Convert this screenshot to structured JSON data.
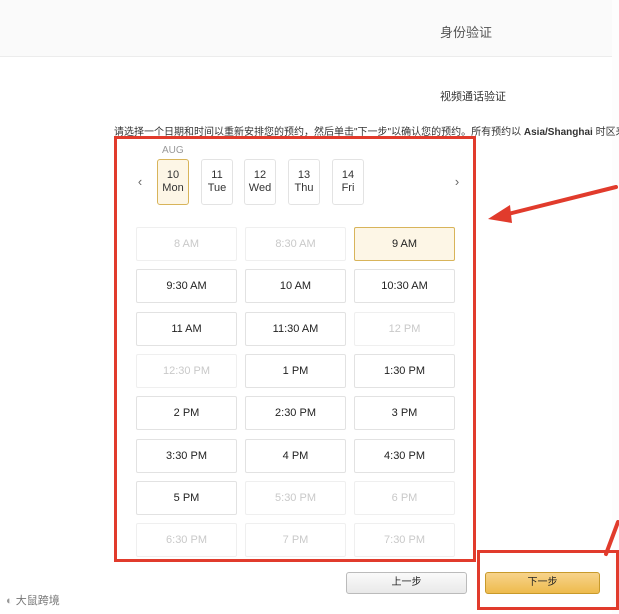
{
  "header": {
    "title": "身份验证"
  },
  "page": {
    "subtitle": "视频通话验证",
    "instruction_prefix": "请选择一个日期和时间以重新安排您的预约，然后单击\"下一步\"以确认您的预约。所有预约以 ",
    "instruction_timezone": "Asia/Shanghai",
    "instruction_suffix": " 时区来"
  },
  "calendar": {
    "month": "AUG",
    "dates": [
      {
        "day": "10",
        "weekday": "Mon",
        "selected": true
      },
      {
        "day": "11",
        "weekday": "Tue",
        "selected": false
      },
      {
        "day": "12",
        "weekday": "Wed",
        "selected": false
      },
      {
        "day": "13",
        "weekday": "Thu",
        "selected": false
      },
      {
        "day": "14",
        "weekday": "Fri",
        "selected": false
      }
    ],
    "prev_icon": "‹",
    "next_icon": "›"
  },
  "slots": [
    {
      "label": "8 AM",
      "state": "disabled"
    },
    {
      "label": "8:30 AM",
      "state": "disabled"
    },
    {
      "label": "9 AM",
      "state": "selected"
    },
    {
      "label": "9:30 AM",
      "state": "available"
    },
    {
      "label": "10 AM",
      "state": "available"
    },
    {
      "label": "10:30 AM",
      "state": "available"
    },
    {
      "label": "11 AM",
      "state": "available"
    },
    {
      "label": "11:30 AM",
      "state": "available"
    },
    {
      "label": "12 PM",
      "state": "disabled"
    },
    {
      "label": "12:30 PM",
      "state": "disabled"
    },
    {
      "label": "1 PM",
      "state": "available"
    },
    {
      "label": "1:30 PM",
      "state": "available"
    },
    {
      "label": "2 PM",
      "state": "available"
    },
    {
      "label": "2:30 PM",
      "state": "available"
    },
    {
      "label": "3 PM",
      "state": "available"
    },
    {
      "label": "3:30 PM",
      "state": "available"
    },
    {
      "label": "4 PM",
      "state": "available"
    },
    {
      "label": "4:30 PM",
      "state": "available"
    },
    {
      "label": "5 PM",
      "state": "available"
    },
    {
      "label": "5:30 PM",
      "state": "disabled"
    },
    {
      "label": "6 PM",
      "state": "disabled"
    },
    {
      "label": "6:30 PM",
      "state": "disabled"
    },
    {
      "label": "7 PM",
      "state": "disabled"
    },
    {
      "label": "7:30 PM",
      "state": "disabled"
    }
  ],
  "footer": {
    "prev_label": "上一步",
    "next_label": "下一步"
  },
  "watermark": "大鼠跨境",
  "colors": {
    "accent_red": "#e13b2c",
    "selected_border": "#d8b45a",
    "selected_bg": "#fdf6e6",
    "next_button": "#eebb4d"
  }
}
